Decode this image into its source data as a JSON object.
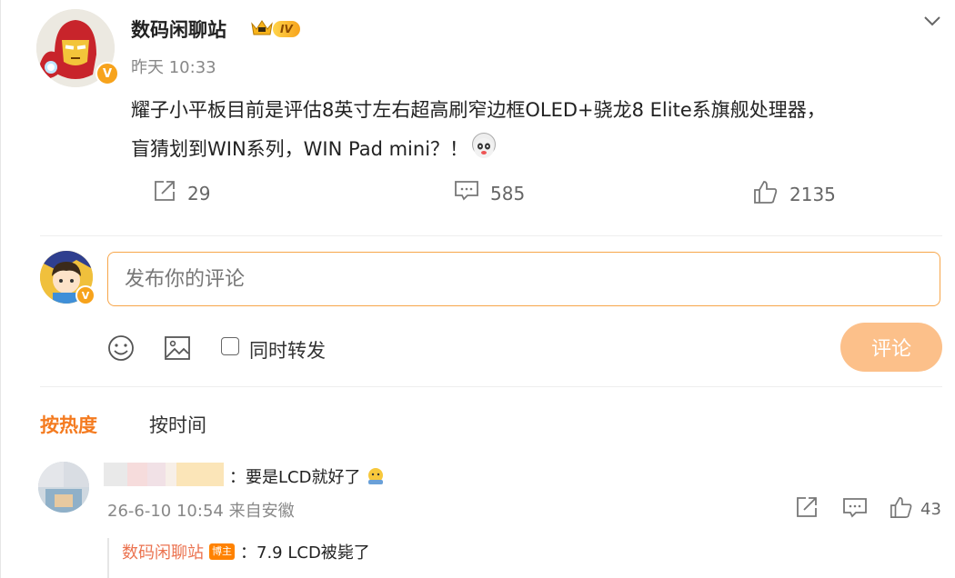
{
  "post": {
    "author": "数码闲聊站",
    "level_badge": "IV",
    "verified_mark": "V",
    "time": "昨天 10:33",
    "text_line1": "耀子小平板目前是评估8英寸左右超高刷窄边框OLED+骁龙8 Elite系旗舰处理器，",
    "text_line2": "盲猜划到WIN系列，WIN Pad mini？！",
    "emoji_icon": "doge-emoji-icon",
    "actions": {
      "repost_count": "29",
      "comment_count": "585",
      "like_count": "2135"
    }
  },
  "composer": {
    "placeholder": "发布你的评论",
    "repost_label": "同时转发",
    "submit_label": "评论"
  },
  "sort_tabs": {
    "hot": "按热度",
    "time": "按时间"
  },
  "comments": [
    {
      "text": "：要是LCD就好了",
      "time": "26-6-10 10:54 来自安徽",
      "like_count": "43",
      "reply": {
        "author": "数码闲聊站",
        "badge": "博主",
        "text": "：7.9 LCD被毙了"
      }
    }
  ],
  "colors": {
    "accent": "#f47b20",
    "input_border": "#f7a64a",
    "submit_bg": "#fcc08a",
    "reply_name": "#eb7350"
  }
}
